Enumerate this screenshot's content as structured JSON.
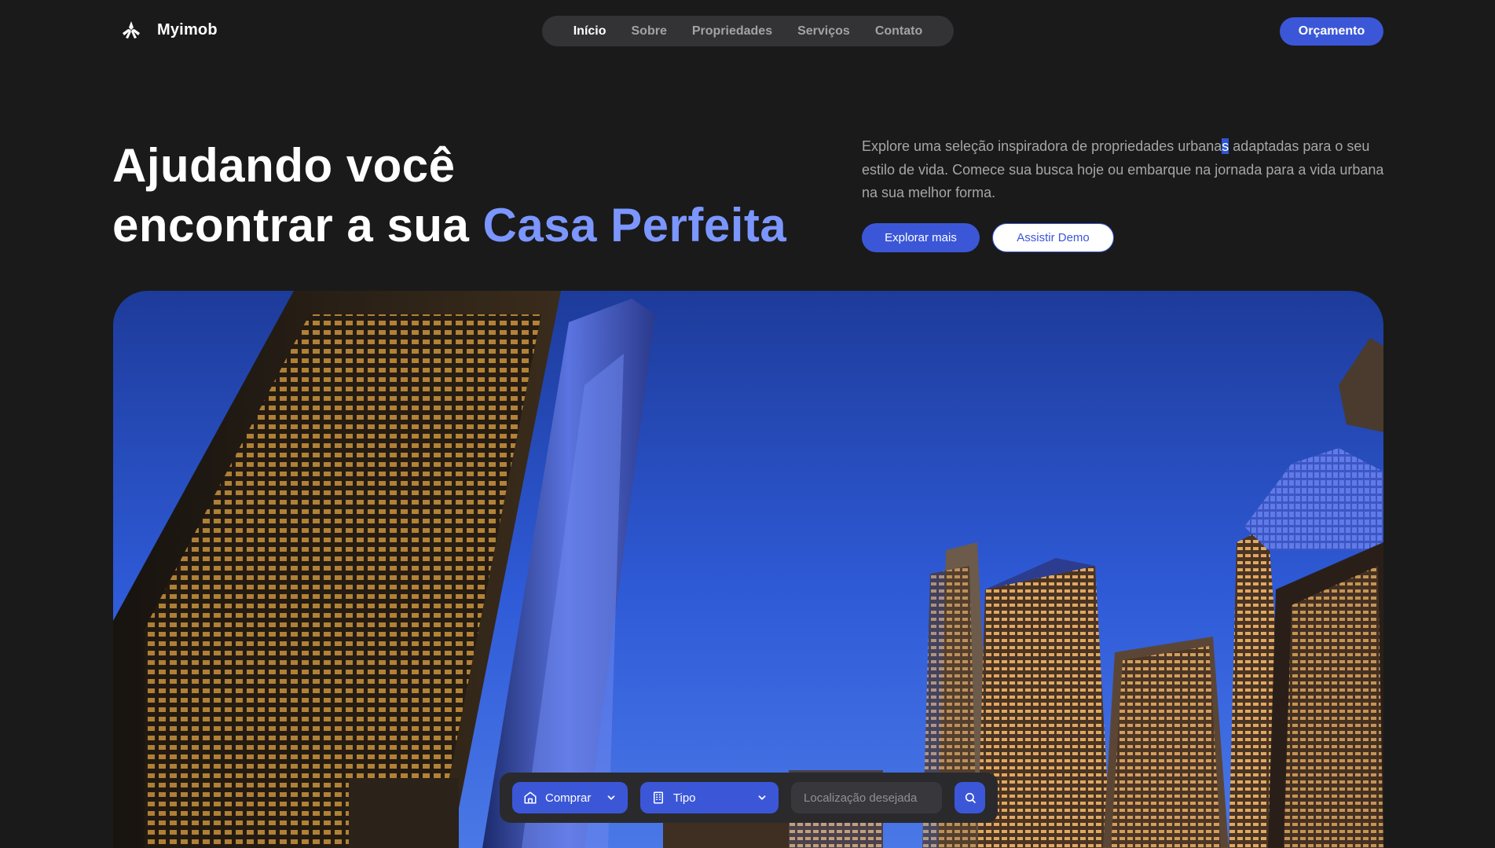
{
  "brand": {
    "name": "Myimob",
    "logo_icon": "tri-blade-logo-icon"
  },
  "nav": {
    "items": [
      {
        "label": "Início",
        "active": true
      },
      {
        "label": "Sobre",
        "active": false
      },
      {
        "label": "Propriedades",
        "active": false
      },
      {
        "label": "Serviços",
        "active": false
      },
      {
        "label": "Contato",
        "active": false
      }
    ]
  },
  "header": {
    "cta_label": "Orçamento"
  },
  "hero": {
    "headline_line1": "Ajudando você",
    "headline_line2": "encontrar a sua ",
    "headline_accent": "Casa Perfeita",
    "description_before": "Explore uma seleção inspiradora de propriedades urbana",
    "description_selected": "s",
    "description_after": " adaptadas para o seu estilo de vida. Comece sua busca hoje ou embarque na jornada para a vida urbana na sua melhor forma.",
    "primary_button": "Explorar mais",
    "secondary_button": "Assistir Demo"
  },
  "search": {
    "transaction": {
      "value": "Comprar",
      "icon": "home-icon"
    },
    "property_type": {
      "value": "Tipo",
      "icon": "building-icon"
    },
    "location_placeholder": "Localização desejada",
    "search_icon": "search-icon"
  },
  "colors": {
    "background": "#1a1a1a",
    "accent": "#3b57d8",
    "accent_text": "#7b96ff",
    "nav_bg": "#333336"
  }
}
